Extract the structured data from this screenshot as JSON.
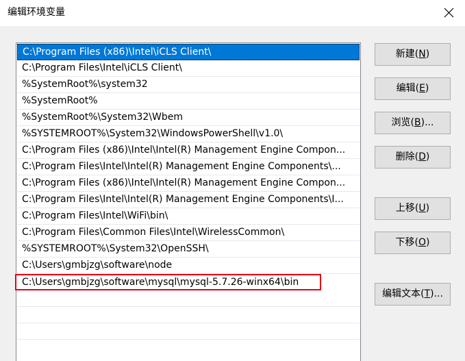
{
  "window": {
    "title": "编辑环境变量"
  },
  "path_list": {
    "entries": [
      "C:\\Program Files (x86)\\Intel\\iCLS Client\\",
      "C:\\Program Files\\Intel\\iCLS Client\\",
      "%SystemRoot%\\system32",
      "%SystemRoot%",
      "%SystemRoot%\\System32\\Wbem",
      "%SYSTEMROOT%\\System32\\WindowsPowerShell\\v1.0\\",
      "C:\\Program Files (x86)\\Intel\\Intel(R) Management Engine Compon...",
      "C:\\Program Files\\Intel\\Intel(R) Management Engine Components\\...",
      "C:\\Program Files (x86)\\Intel\\Intel(R) Management Engine Compon...",
      "C:\\Program Files\\Intel\\Intel(R) Management Engine Components\\I...",
      "C:\\Program Files\\Intel\\WiFi\\bin\\",
      "C:\\Program Files\\Common Files\\Intel\\WirelessCommon\\",
      "%SYSTEMROOT%\\System32\\OpenSSH\\",
      "C:\\Users\\gmbjzg\\software\\node",
      "C:\\Users\\gmbjzg\\software\\mysql\\mysql-5.7.26-winx64\\bin",
      "",
      "",
      ""
    ],
    "selected_index": 0,
    "highlighted_index": 14
  },
  "buttons": {
    "new": {
      "label": "新建(",
      "key": "N",
      "end": ")"
    },
    "edit": {
      "label": "编辑(",
      "key": "E",
      "end": ")"
    },
    "browse": {
      "label": "浏览(",
      "key": "B",
      "end": ")..."
    },
    "delete": {
      "label": "删除(",
      "key": "D",
      "end": ")"
    },
    "move_up": {
      "label": "上移(",
      "key": "U",
      "end": ")"
    },
    "move_down": {
      "label": "下移(",
      "key": "O",
      "end": ")"
    },
    "edit_text": {
      "label": "编辑文本(",
      "key": "T",
      "end": ")..."
    }
  },
  "colors": {
    "selection": "#0078d7",
    "highlight_border": "#e60012"
  }
}
